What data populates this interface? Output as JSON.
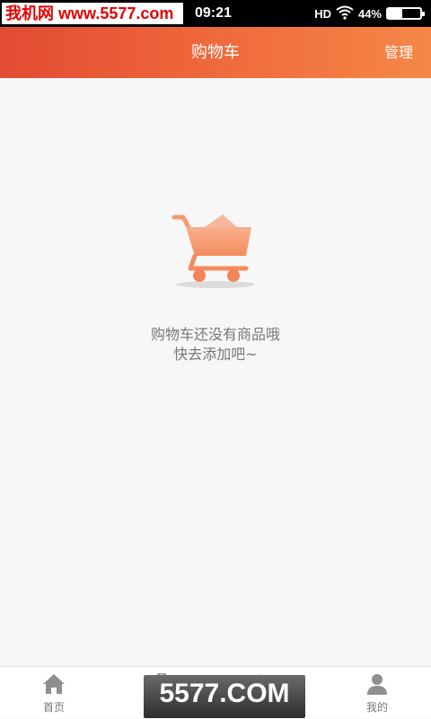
{
  "status_bar": {
    "watermark": "我机网 www.5577.com",
    "time": "09:21",
    "network": "HD",
    "battery": "44%",
    "battery_level": 0.44
  },
  "header": {
    "title": "购物车",
    "manage_label": "管理"
  },
  "empty_state": {
    "line1": "购物车还没有商品哦",
    "line2": "快去添加吧~",
    "icon": "shopping-cart-icon",
    "accent": "#f47a45"
  },
  "tabbar": {
    "tabs": [
      {
        "label": "首页",
        "icon": "home-icon"
      },
      {
        "label": "",
        "icon": "shopping-bag-icon"
      },
      {
        "label": "",
        "icon": "cart-icon",
        "active": true
      },
      {
        "label": "我的",
        "icon": "user-icon"
      }
    ]
  },
  "overlay_watermark": {
    "text": "5577.COM"
  },
  "colors": {
    "header_start": "#e34b33",
    "header_end": "#f58748",
    "background": "#f7f7f7"
  }
}
